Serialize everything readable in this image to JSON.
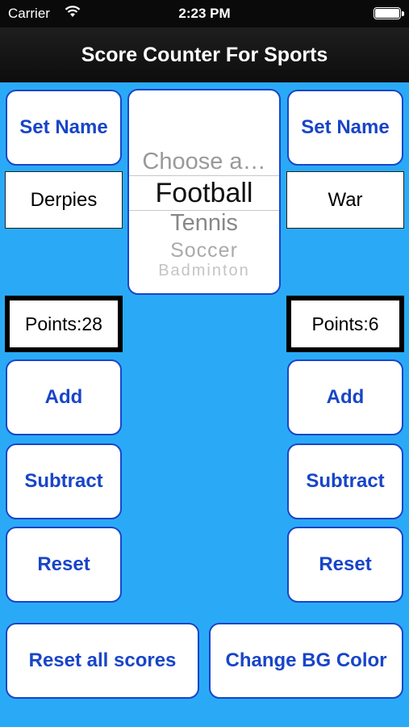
{
  "status_bar": {
    "carrier": "Carrier",
    "time": "2:23 PM"
  },
  "nav": {
    "title": "Score Counter For Sports"
  },
  "left": {
    "set_name": "Set Name",
    "team_name": "Derpies",
    "points": "Points:28",
    "add": "Add",
    "subtract": "Subtract",
    "reset": "Reset"
  },
  "right": {
    "set_name": "Set Name",
    "team_name": "War",
    "points": "Points:6",
    "add": "Add",
    "subtract": "Subtract",
    "reset": "Reset"
  },
  "picker": {
    "selected": "Football",
    "options": [
      "Choose a…",
      "Football",
      "Tennis",
      "Soccer",
      "Badminton"
    ]
  },
  "bottom": {
    "reset_all": "Reset all scores",
    "change_bg": "Change BG Color"
  },
  "colors": {
    "background": "#2aaaf6",
    "button_text": "#1845c8",
    "nav_bar": "#111111"
  }
}
